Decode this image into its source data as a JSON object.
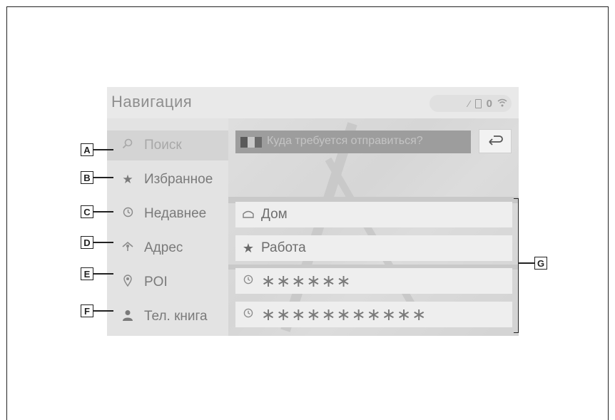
{
  "header": {
    "title": "Навигация"
  },
  "status": {
    "zero": "0"
  },
  "search": {
    "placeholder": "Куда требуется отправиться?"
  },
  "sidebar": {
    "items": [
      {
        "label": "Поиск",
        "icon": "search-icon",
        "marker": "A"
      },
      {
        "label": "Избранное",
        "icon": "star-icon",
        "marker": "B"
      },
      {
        "label": "Недавнее",
        "icon": "clock-icon",
        "marker": "C"
      },
      {
        "label": "Адрес",
        "icon": "address-icon",
        "marker": "D"
      },
      {
        "label": "POI",
        "icon": "pin-icon",
        "marker": "E"
      },
      {
        "label": "Тел. книга",
        "icon": "person-icon",
        "marker": "F"
      }
    ]
  },
  "destinations": [
    {
      "label": "Дом",
      "icon": "home-icon"
    },
    {
      "label": "Работа",
      "icon": "star-icon"
    },
    {
      "label": "∗∗∗∗∗∗",
      "icon": "clock-icon"
    },
    {
      "label": "∗∗∗∗∗∗∗∗∗∗∗",
      "icon": "clock-icon"
    }
  ],
  "callout": {
    "list_marker": "G"
  },
  "colors": {
    "screen_bg": "#e6e6e6",
    "search_bar": "#9d9d9d",
    "text": "#7a7a7a"
  }
}
